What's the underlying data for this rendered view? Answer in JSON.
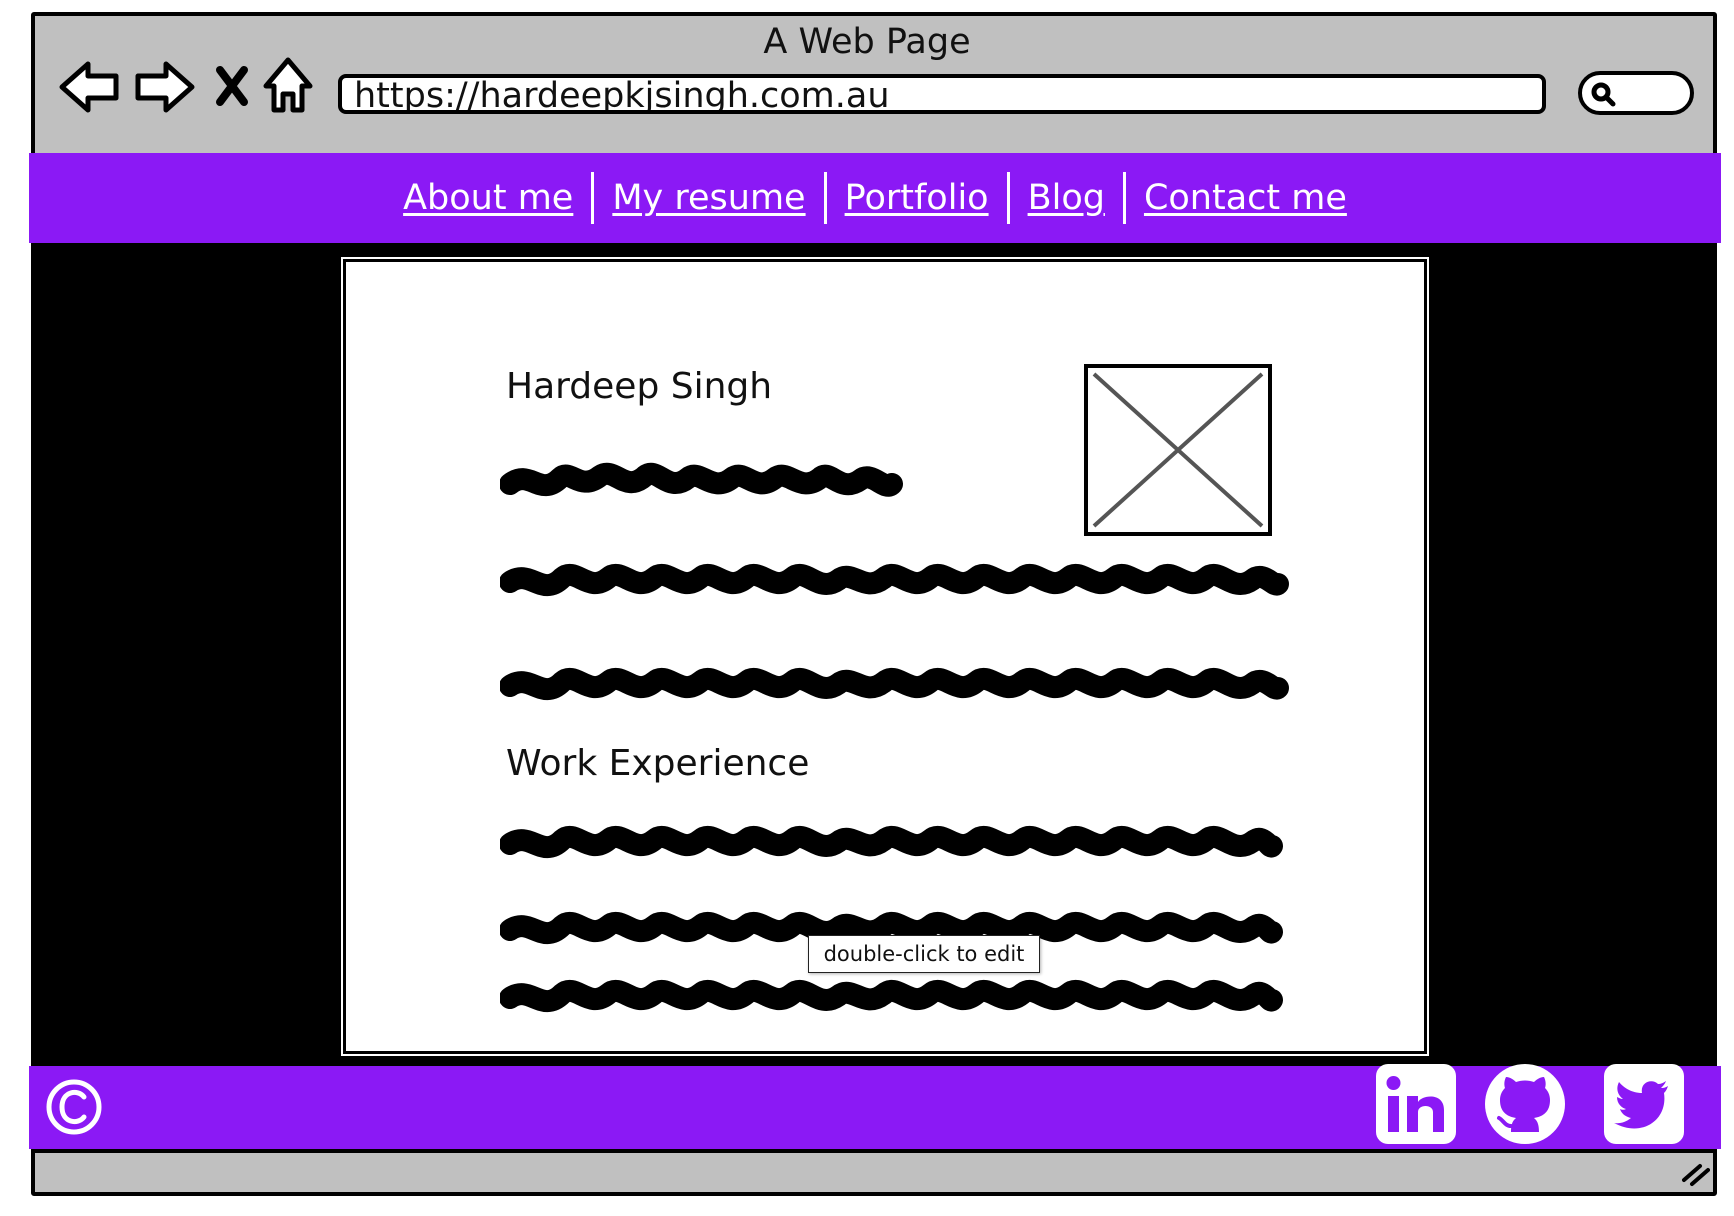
{
  "browser": {
    "title": "A Web Page",
    "url": "https://hardeepkjsingh.com.au",
    "nav_icons": [
      "back-arrow-icon",
      "forward-arrow-icon",
      "close-icon",
      "home-icon"
    ],
    "search_icon": "search-icon"
  },
  "nav": {
    "links": [
      {
        "label": "About me"
      },
      {
        "label": "My resume"
      },
      {
        "label": "Portfolio"
      },
      {
        "label": "Blog"
      },
      {
        "label": "Contact me"
      }
    ],
    "background": "#8b19f5",
    "text_color": "#ffffff"
  },
  "card": {
    "name_heading": "Hardeep Singh",
    "section_heading": "Work Experience",
    "image_placeholder_icon": "image-placeholder-icon"
  },
  "tooltip": {
    "text": "double-click to edit"
  },
  "footer": {
    "copyright_icon": "copyright-icon",
    "social_icons": [
      "linkedin-icon",
      "github-icon",
      "twitter-icon"
    ],
    "background": "#8b19f5"
  }
}
